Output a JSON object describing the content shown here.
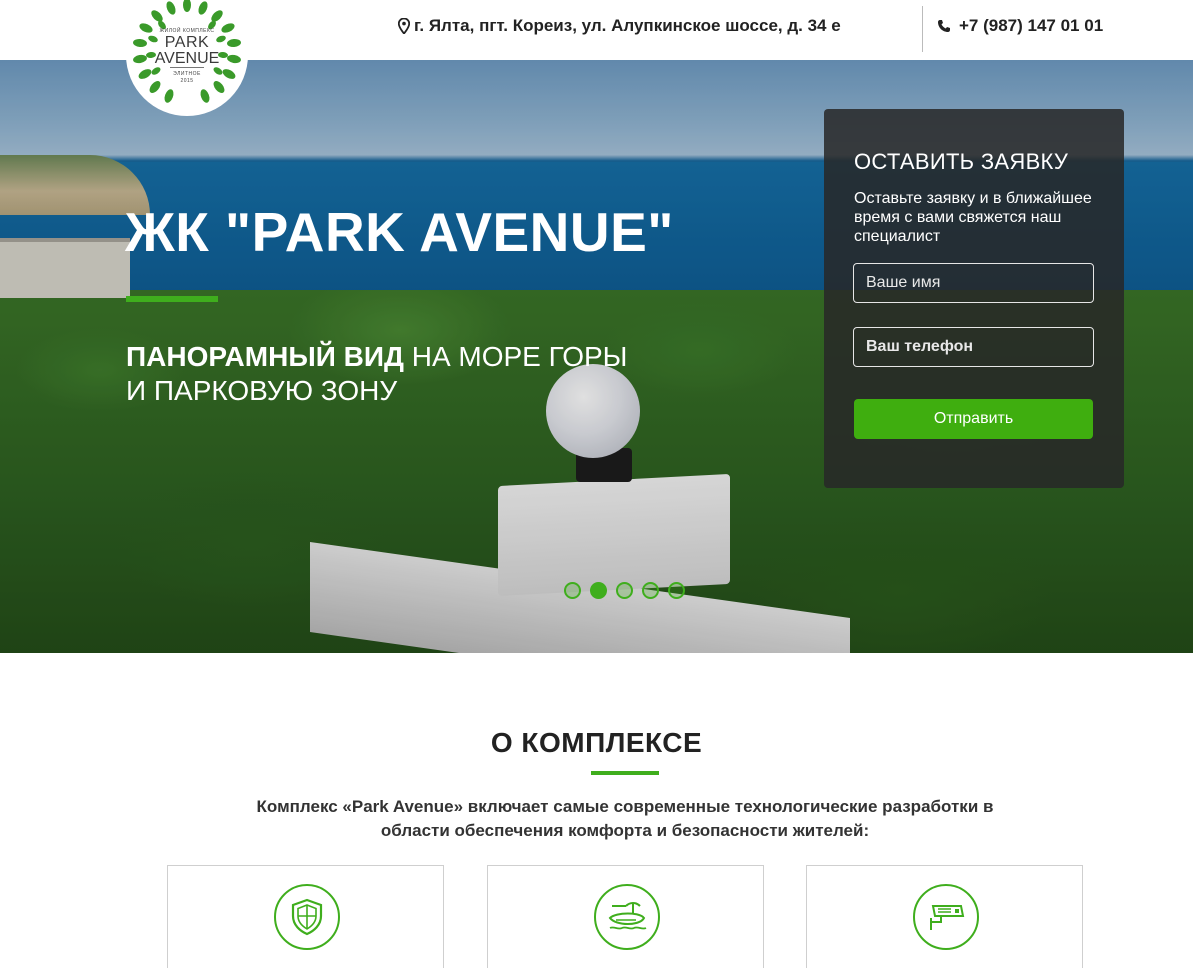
{
  "header": {
    "logo": {
      "top_text": "ЖИЛОЙ КОМПЛЕКС",
      "name_line1": "PARK",
      "name_line2": "AVENUE",
      "bottom_text": "ЭЛИТНОЕ",
      "year_text": "2015"
    },
    "address": "г. Ялта, пгт. Кореиз, ул. Алупкинское шоссе, д. 34 е",
    "phone": "+7 (987) 147 01 01",
    "icons": {
      "address": "map-marker-icon",
      "phone": "phone-icon"
    }
  },
  "hero": {
    "title": "ЖК \"PARK AVENUE\"",
    "subtitle_bold": "ПАНОРАМНЫЙ ВИД",
    "subtitle_rest_line1": " НА МОРЕ ГОРЫ",
    "subtitle_line2": "И ПАРКОВУЮ ЗОНУ",
    "slides_total": 5,
    "active_slide": 2
  },
  "form": {
    "title": "ОСТАВИТЬ ЗАЯВКУ",
    "description": "Оставьте заявку и в ближайшее время с вами свяжется наш специалист",
    "name_placeholder": "Ваше имя",
    "phone_placeholder": "Ваш телефон",
    "submit_label": "Отправить"
  },
  "about": {
    "title": "О КОМПЛЕКСЕ",
    "description": "Комплекс «Park Avenue» включает самые современные технологические разработки в области обеспечения комфорта и безопасности жителей:",
    "cards": [
      {
        "icon": "shield-icon"
      },
      {
        "icon": "pool-icon"
      },
      {
        "icon": "cctv-camera-icon"
      }
    ]
  },
  "colors": {
    "accent": "#3fae1d",
    "text_dark": "#222222",
    "form_bg": "#282828"
  }
}
